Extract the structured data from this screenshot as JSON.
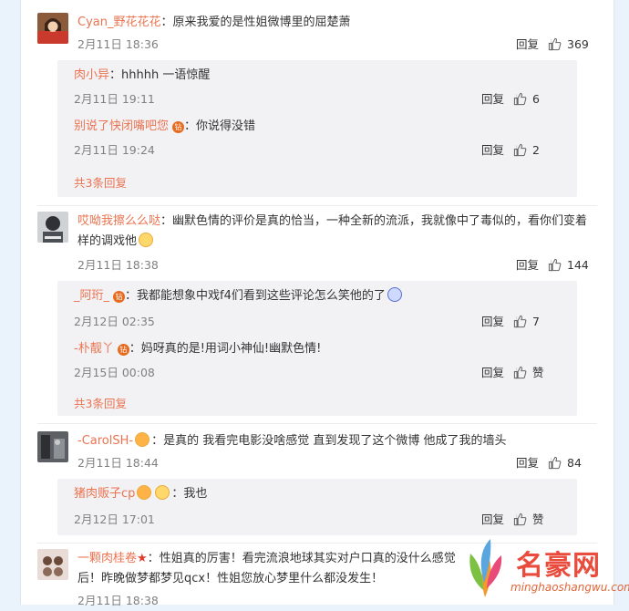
{
  "comments": [
    {
      "user": "Cyan_野花花花",
      "text": "原来我爱的是性姐微博里的屈楚萧",
      "time": "2月11日 18:36",
      "reply": "回复",
      "likes": "369",
      "subs": [
        {
          "user": "肉小异",
          "text": "hhhhh 一语惊醒",
          "time": "2月11日 19:11",
          "reply": "回复",
          "likes": "6"
        },
        {
          "user": "别说了快闭嘴吧您",
          "text": "你说得没错",
          "time": "2月11日 19:24",
          "reply": "回复",
          "likes": "2"
        }
      ],
      "more": "共3条回复"
    },
    {
      "user": "哎呦我擦么么哒",
      "text1": "幽默色情的评价是真的恰当，一种全新的流派，我就像中了毒似的，看你们变着",
      "text2": "样的调戏他",
      "time": "2月11日 18:38",
      "reply": "回复",
      "likes": "144",
      "subs": [
        {
          "user": "_阿珩_",
          "text": "我都能想象中戏f4们看到这些评论怎么笑他的了",
          "time": "2月12日 02:35",
          "reply": "回复",
          "likes": "7"
        },
        {
          "user": "-朴靓丫",
          "text": "妈呀真的是!用词小神仙!幽默色情!",
          "time": "2月15日 00:08",
          "reply": "回复",
          "likes": "赞"
        }
      ],
      "more": "共3条回复"
    },
    {
      "user": "-CarolSH-",
      "text": "是真的 我看完电影没啥感觉 直到发现了这个微博 他成了我的墙头",
      "time": "2月11日 18:44",
      "reply": "回复",
      "likes": "84",
      "subs": [
        {
          "user": "猪肉贩子cp",
          "text": "我也",
          "time": "2月12日 17:01",
          "reply": "回复",
          "likes": "赞"
        }
      ]
    },
    {
      "user": "一颗肉桂卷",
      "text1": "性姐真的厉害！看完流浪地球其实对户口真的没什么感觉",
      "text2": "后！昨晚做梦都梦见qcx！性姐您放心梦里什么都没发生！",
      "time": "2月11日 18:38"
    }
  ],
  "watermark": {
    "brand": "名豪网",
    "domain": "minghaoshangwu.com"
  },
  "badge_text": "钻",
  "colors": {
    "accent": "#eb7350",
    "subBg": "#f2f2f5"
  }
}
